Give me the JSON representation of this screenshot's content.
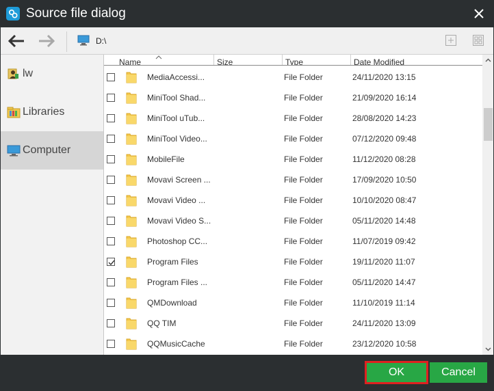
{
  "window": {
    "title": "Source file dialog"
  },
  "toolbar": {
    "path": "D:\\"
  },
  "sidebar": {
    "items": [
      {
        "label": "lw"
      },
      {
        "label": "Libraries"
      },
      {
        "label": "Computer"
      }
    ],
    "selected": "Computer"
  },
  "columns": {
    "name": "Name",
    "size": "Size",
    "type": "Type",
    "date": "Date Modified"
  },
  "rows": [
    {
      "name": "MediaAccessi...",
      "type": "File Folder",
      "date": "24/11/2020 13:15",
      "checked": false
    },
    {
      "name": "MiniTool Shad...",
      "type": "File Folder",
      "date": "21/09/2020 16:14",
      "checked": false
    },
    {
      "name": "MiniTool uTub...",
      "type": "File Folder",
      "date": "28/08/2020 14:23",
      "checked": false
    },
    {
      "name": "MiniTool Video...",
      "type": "File Folder",
      "date": "07/12/2020 09:48",
      "checked": false
    },
    {
      "name": "MobileFile",
      "type": "File Folder",
      "date": "11/12/2020 08:28",
      "checked": false
    },
    {
      "name": "Movavi Screen ...",
      "type": "File Folder",
      "date": "17/09/2020 10:50",
      "checked": false
    },
    {
      "name": "Movavi Video ...",
      "type": "File Folder",
      "date": "10/10/2020 08:47",
      "checked": false
    },
    {
      "name": "Movavi Video S...",
      "type": "File Folder",
      "date": "05/11/2020 14:48",
      "checked": false
    },
    {
      "name": "Photoshop CC...",
      "type": "File Folder",
      "date": "11/07/2019 09:42",
      "checked": false
    },
    {
      "name": "Program Files",
      "type": "File Folder",
      "date": "19/11/2020 11:07",
      "checked": true
    },
    {
      "name": "Program Files ...",
      "type": "File Folder",
      "date": "05/11/2020 14:47",
      "checked": false
    },
    {
      "name": "QMDownload",
      "type": "File Folder",
      "date": "11/10/2019 11:14",
      "checked": false
    },
    {
      "name": "QQ TIM",
      "type": "File Folder",
      "date": "24/11/2020 13:09",
      "checked": false
    },
    {
      "name": "QQMusicCache",
      "type": "File Folder",
      "date": "23/12/2020 10:58",
      "checked": false
    }
  ],
  "buttons": {
    "ok": "OK",
    "cancel": "Cancel"
  },
  "colors": {
    "chrome": "#2b2f31",
    "button_green": "#28a745",
    "highlight_red": "#e02020",
    "folder_yellow": "#f5c84c"
  },
  "icons": {
    "app": "app-logo-icon",
    "close": "close-icon",
    "back": "arrow-left-icon",
    "forward": "arrow-right-icon",
    "path": "computer-icon",
    "new_folder": "new-folder-icon",
    "view": "view-mode-icon",
    "user": "user-icon",
    "libraries": "libraries-icon",
    "computer": "computer-icon",
    "folder": "folder-icon"
  }
}
